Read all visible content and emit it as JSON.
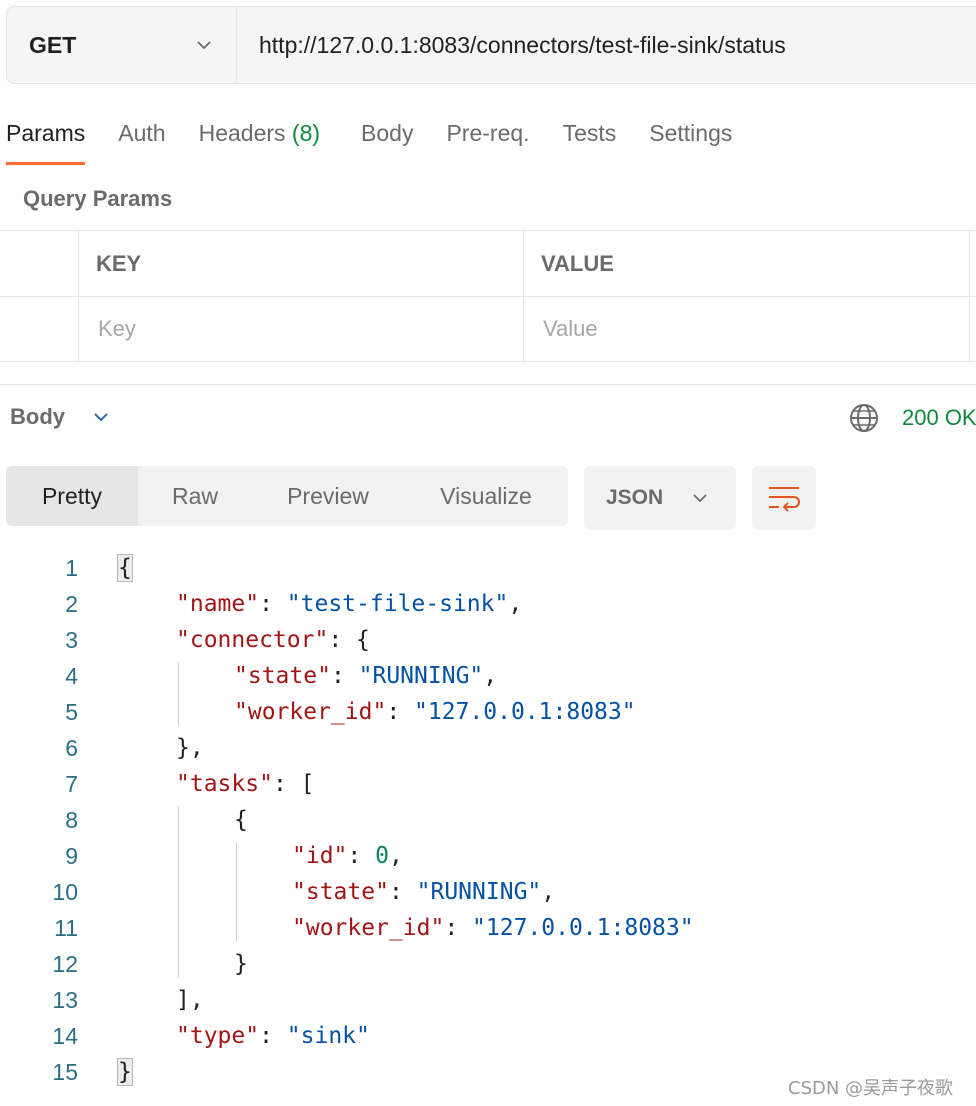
{
  "request": {
    "method": "GET",
    "url": "http://127.0.0.1:8083/connectors/test-file-sink/status"
  },
  "tabs": [
    {
      "label": "Params",
      "active": true
    },
    {
      "label": "Auth"
    },
    {
      "label": "Headers",
      "count": "(8)"
    },
    {
      "label": "Body"
    },
    {
      "label": "Pre-req."
    },
    {
      "label": "Tests"
    },
    {
      "label": "Settings"
    }
  ],
  "query_params": {
    "title": "Query Params",
    "headers": {
      "key": "KEY",
      "value": "VALUE"
    },
    "placeholders": {
      "key": "Key",
      "value": "Value"
    }
  },
  "response": {
    "body_label": "Body",
    "status": "200 OK",
    "views": [
      "Pretty",
      "Raw",
      "Preview",
      "Visualize"
    ],
    "active_view": "Pretty",
    "format": "JSON",
    "lines": [
      [
        {
          "t": "{"
        }
      ],
      [
        {
          "t": "\"name\"",
          "c": "k"
        },
        {
          "t": ": "
        },
        {
          "t": "\"test-file-sink\"",
          "c": "s"
        },
        {
          "t": ","
        }
      ],
      [
        {
          "t": "\"connector\"",
          "c": "k"
        },
        {
          "t": ": {"
        }
      ],
      [
        {
          "t": "\"state\"",
          "c": "k"
        },
        {
          "t": ": "
        },
        {
          "t": "\"RUNNING\"",
          "c": "s"
        },
        {
          "t": ","
        }
      ],
      [
        {
          "t": "\"worker_id\"",
          "c": "k"
        },
        {
          "t": ": "
        },
        {
          "t": "\"127.0.0.1:8083\"",
          "c": "s"
        }
      ],
      [
        {
          "t": "},"
        }
      ],
      [
        {
          "t": "\"tasks\"",
          "c": "k"
        },
        {
          "t": ": ["
        }
      ],
      [
        {
          "t": "{"
        }
      ],
      [
        {
          "t": "\"id\"",
          "c": "k"
        },
        {
          "t": ": "
        },
        {
          "t": "0",
          "c": "n"
        },
        {
          "t": ","
        }
      ],
      [
        {
          "t": "\"state\"",
          "c": "k"
        },
        {
          "t": ": "
        },
        {
          "t": "\"RUNNING\"",
          "c": "s"
        },
        {
          "t": ","
        }
      ],
      [
        {
          "t": "\"worker_id\"",
          "c": "k"
        },
        {
          "t": ": "
        },
        {
          "t": "\"127.0.0.1:8083\"",
          "c": "s"
        }
      ],
      [
        {
          "t": "}"
        }
      ],
      [
        {
          "t": "],"
        }
      ],
      [
        {
          "t": "\"type\"",
          "c": "k"
        },
        {
          "t": ": "
        },
        {
          "t": "\"sink\"",
          "c": "s"
        }
      ],
      [
        {
          "t": "}"
        }
      ]
    ],
    "line_numbers": [
      "1",
      "2",
      "3",
      "4",
      "5",
      "6",
      "7",
      "8",
      "9",
      "10",
      "11",
      "12",
      "13",
      "14",
      "15"
    ]
  },
  "watermark": "CSDN @吴声子夜歌",
  "icons": {
    "method_dropdown": "chevron-down-icon",
    "body_dropdown": "chevron-down-icon",
    "status": "globe-icon",
    "format_dropdown": "chevron-down-icon",
    "wrap": "wrap-lines-icon"
  },
  "colors": {
    "accent": "#ff6c37",
    "status_ok": "#0f8a3c",
    "json_key": "#a31515",
    "json_string": "#0451a5",
    "json_number": "#098658",
    "line_number": "#2a6e88"
  }
}
